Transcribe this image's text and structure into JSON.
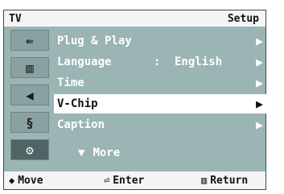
{
  "header": {
    "left": "TV",
    "right": "Setup"
  },
  "side_icons": [
    {
      "name": "input-icon",
      "glyph": "⇚"
    },
    {
      "name": "picture-icon",
      "glyph": "▥"
    },
    {
      "name": "sound-icon",
      "glyph": "◀"
    },
    {
      "name": "channel-icon",
      "glyph": "§"
    },
    {
      "name": "setup-icon",
      "glyph": "⚙"
    }
  ],
  "menu": {
    "items": [
      {
        "label": "Plug & Play",
        "arrow": "▶"
      },
      {
        "label": "Language",
        "sep": ":",
        "value": "English",
        "arrow": "▶"
      },
      {
        "label": "Time",
        "arrow": "▶"
      },
      {
        "label": "V-Chip",
        "arrow": "▶",
        "highlighted": true
      },
      {
        "label": "Caption",
        "arrow": "▶"
      }
    ],
    "more_label": "More",
    "more_icon": "▼"
  },
  "footer": {
    "move_icon": "◆",
    "move_label": "Move",
    "enter_icon": "⏎",
    "enter_label": "Enter",
    "return_icon": "▥",
    "return_label": "Return"
  },
  "colors": {
    "menu_bg": "#9bb4b4",
    "bar_bg": "#f4f4f4",
    "highlight": "#ffffff",
    "icon_selected": "#4f6464"
  }
}
